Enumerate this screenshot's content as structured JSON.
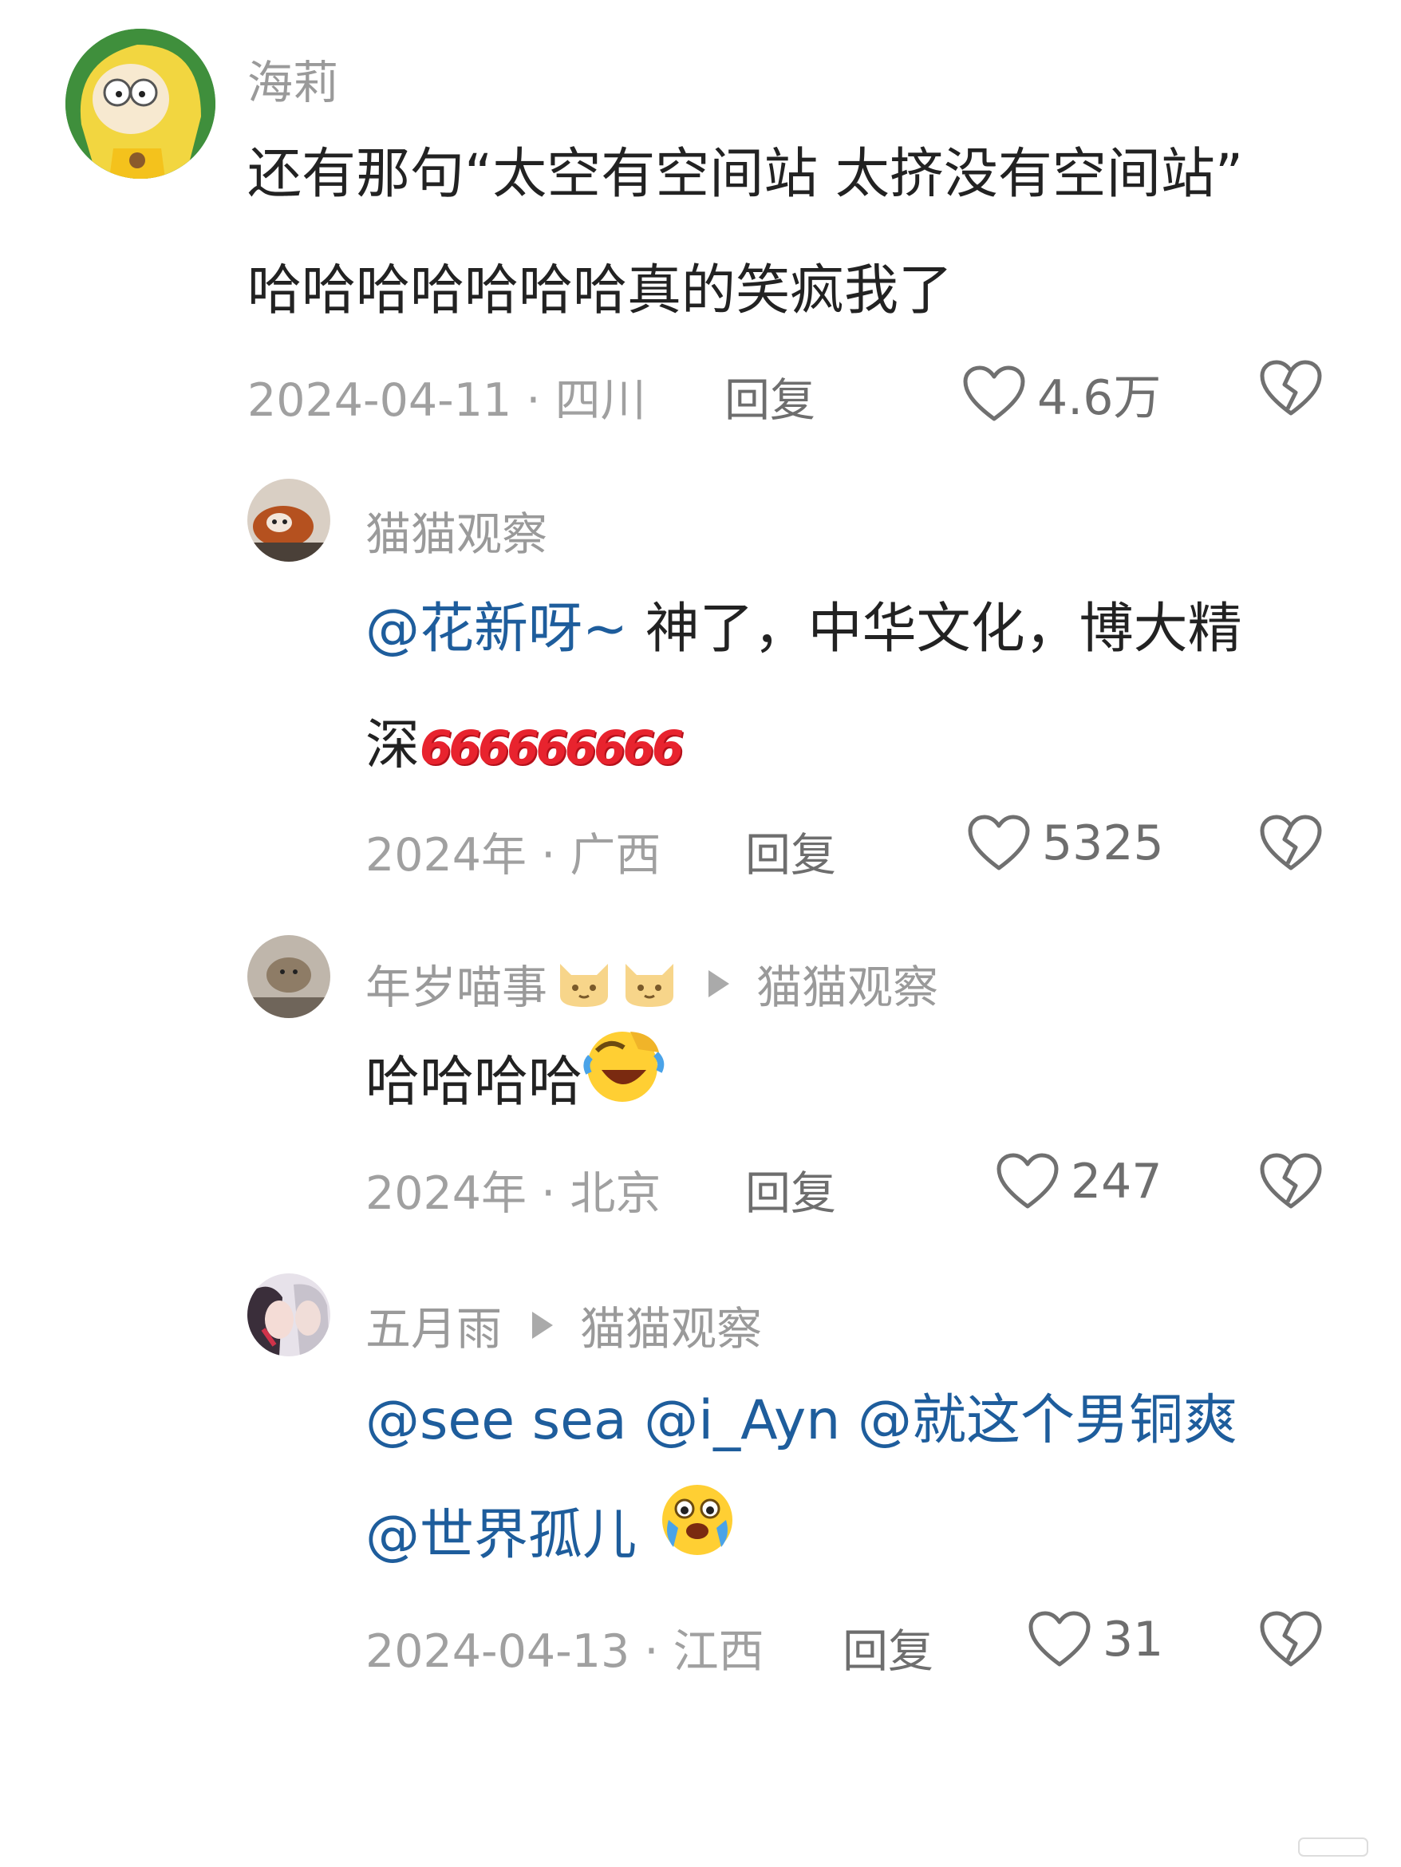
{
  "comments": [
    {
      "username": "海莉",
      "text_line1": "还有那句“太空有空间站 太挤没有空间站”",
      "text_line2": "哈哈哈哈哈哈哈真的笑疯我了",
      "meta": "2024-04-11 · 四川",
      "reply_label": "回复",
      "likes": "4.6万"
    },
    {
      "username": "猫猫观察",
      "mention": "@花新呀~",
      "text_line1": " 神了，中华文化，博大精",
      "text_line2": "深",
      "emoji_text": "666666666",
      "meta": "2024年 · 广西",
      "reply_label": "回复",
      "likes": "5325"
    },
    {
      "username": "年岁喵事",
      "reply_to": "猫猫观察",
      "text_line1": "哈哈哈哈",
      "meta": "2024年 · 北京",
      "reply_label": "回复",
      "likes": "247"
    },
    {
      "username": "五月雨",
      "reply_to": "猫猫观察",
      "mention_line1": "@see sea @i_Ayn @就这个男铜爽",
      "mention_line2": "@世界孤儿",
      "meta": "2024-04-13 · 江西",
      "reply_label": "回复",
      "likes": "31"
    }
  ],
  "icons": {
    "like": "heart-outline-icon",
    "dislike": "broken-heart-icon",
    "reply_arrow": "triangle-right-icon"
  },
  "colors": {
    "mention": "#1e5d9c",
    "secondary_text": "#a0a0a0",
    "primary_text": "#222222"
  }
}
